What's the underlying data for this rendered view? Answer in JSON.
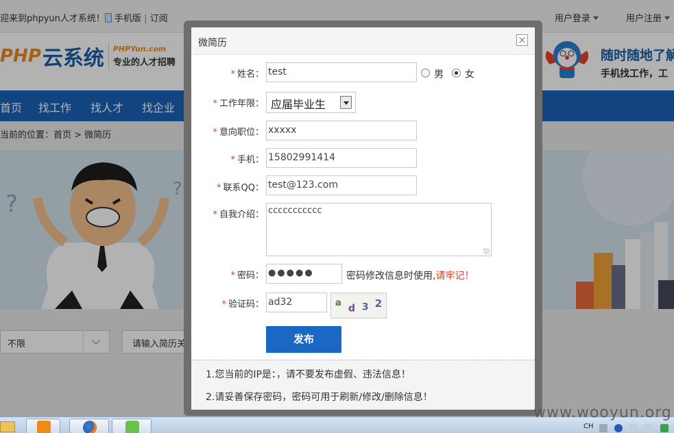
{
  "topbar": {
    "welcome": "迎来到phpyun人才系统！",
    "mobile": "手机版",
    "separator": "|",
    "subscribe": "订阅",
    "login": "用户登录",
    "register": "用户注册"
  },
  "header": {
    "logo_php": "PHP",
    "logo_cn": "云系统",
    "logo_domain": "PHPYun.com",
    "logo_tagline": "专业的人才招聘",
    "slogan_main": "随时随地了解",
    "slogan_sub": "手机找工作，工"
  },
  "nav": {
    "items": [
      "首页",
      "找工作",
      "找人才",
      "找企业"
    ]
  },
  "breadcrumb": "当前的位置：首页 > 微简历",
  "filter": {
    "select_value": "不限",
    "keyword_placeholder": "请输入简历关"
  },
  "modal": {
    "title": "微简历",
    "required_mark": "*",
    "name": {
      "label": "姓名：",
      "value": "test"
    },
    "gender": {
      "male": "男",
      "female": "女",
      "selected": "female"
    },
    "experience": {
      "label": "工作年限：",
      "value": "应届毕业生"
    },
    "position": {
      "label": "意向职位：",
      "value": "xxxxx"
    },
    "phone": {
      "label": "手机：",
      "value": "15802991414"
    },
    "qq": {
      "label": "联系QQ：",
      "value": "test@123.com"
    },
    "intro": {
      "label": "自我介绍：",
      "value": "ccccccccccc"
    },
    "password": {
      "label": "密码：",
      "value": "●●●●●",
      "hint": "密码修改信息时使用,",
      "warning": "请牢记！"
    },
    "captcha": {
      "label": "验证码：",
      "value": "ad32",
      "image_text": [
        "a",
        "d",
        "3",
        "2"
      ]
    },
    "submit": "发布",
    "notices": [
      "1.您当前的IP是：，请不要发布虚假、违法信息！",
      "2.请妥善保存密码，密码可用于刷新/修改/删除信息！"
    ]
  },
  "taskbar": {
    "lang": "CH"
  },
  "watermark": "www.wooyun.org",
  "colors": {
    "nav_blue": "#1a63b8",
    "button_blue": "#1b68c4",
    "required_red": "#e03c1f",
    "logo_orange": "#f08a1a"
  }
}
